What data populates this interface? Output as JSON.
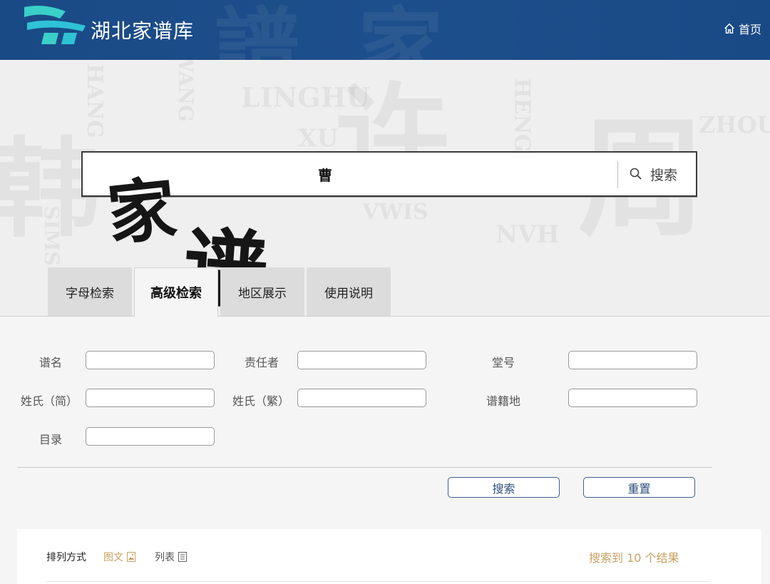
{
  "header": {
    "site_title": "湖北家谱库",
    "home_label": "首页"
  },
  "hero": {
    "calligraphy": [
      "家",
      "谱"
    ],
    "watermarks": [
      "LINGHU",
      "XU",
      "ZHOU",
      "HANG",
      "SIMS",
      "WANG",
      "HENG",
      "NVH",
      "VWIS"
    ],
    "search": {
      "value": "曹",
      "button_label": "搜索"
    }
  },
  "tabs": [
    {
      "label": "字母检索",
      "active": false
    },
    {
      "label": "高级检索",
      "active": true
    },
    {
      "label": "地区展示",
      "active": false
    },
    {
      "label": "使用说明",
      "active": false
    }
  ],
  "form": {
    "fields": [
      {
        "label": "谱名",
        "value": ""
      },
      {
        "label": "责任者",
        "value": ""
      },
      {
        "label": "堂号",
        "value": ""
      },
      {
        "label": "姓氏（简）",
        "value": ""
      },
      {
        "label": "姓氏（繁）",
        "value": ""
      },
      {
        "label": "谱籍地",
        "value": ""
      },
      {
        "label": "目录",
        "value": ""
      }
    ],
    "search_button": "搜索",
    "reset_button": "重置"
  },
  "results": {
    "sort_label": "排列方式",
    "view_image": "图文",
    "view_list": "列表",
    "count_text": "搜索到 10 个结果"
  },
  "colors": {
    "header_bg": "#1d4f8c",
    "accent_gold": "#c8a062",
    "button_border": "#3e5f8a"
  }
}
